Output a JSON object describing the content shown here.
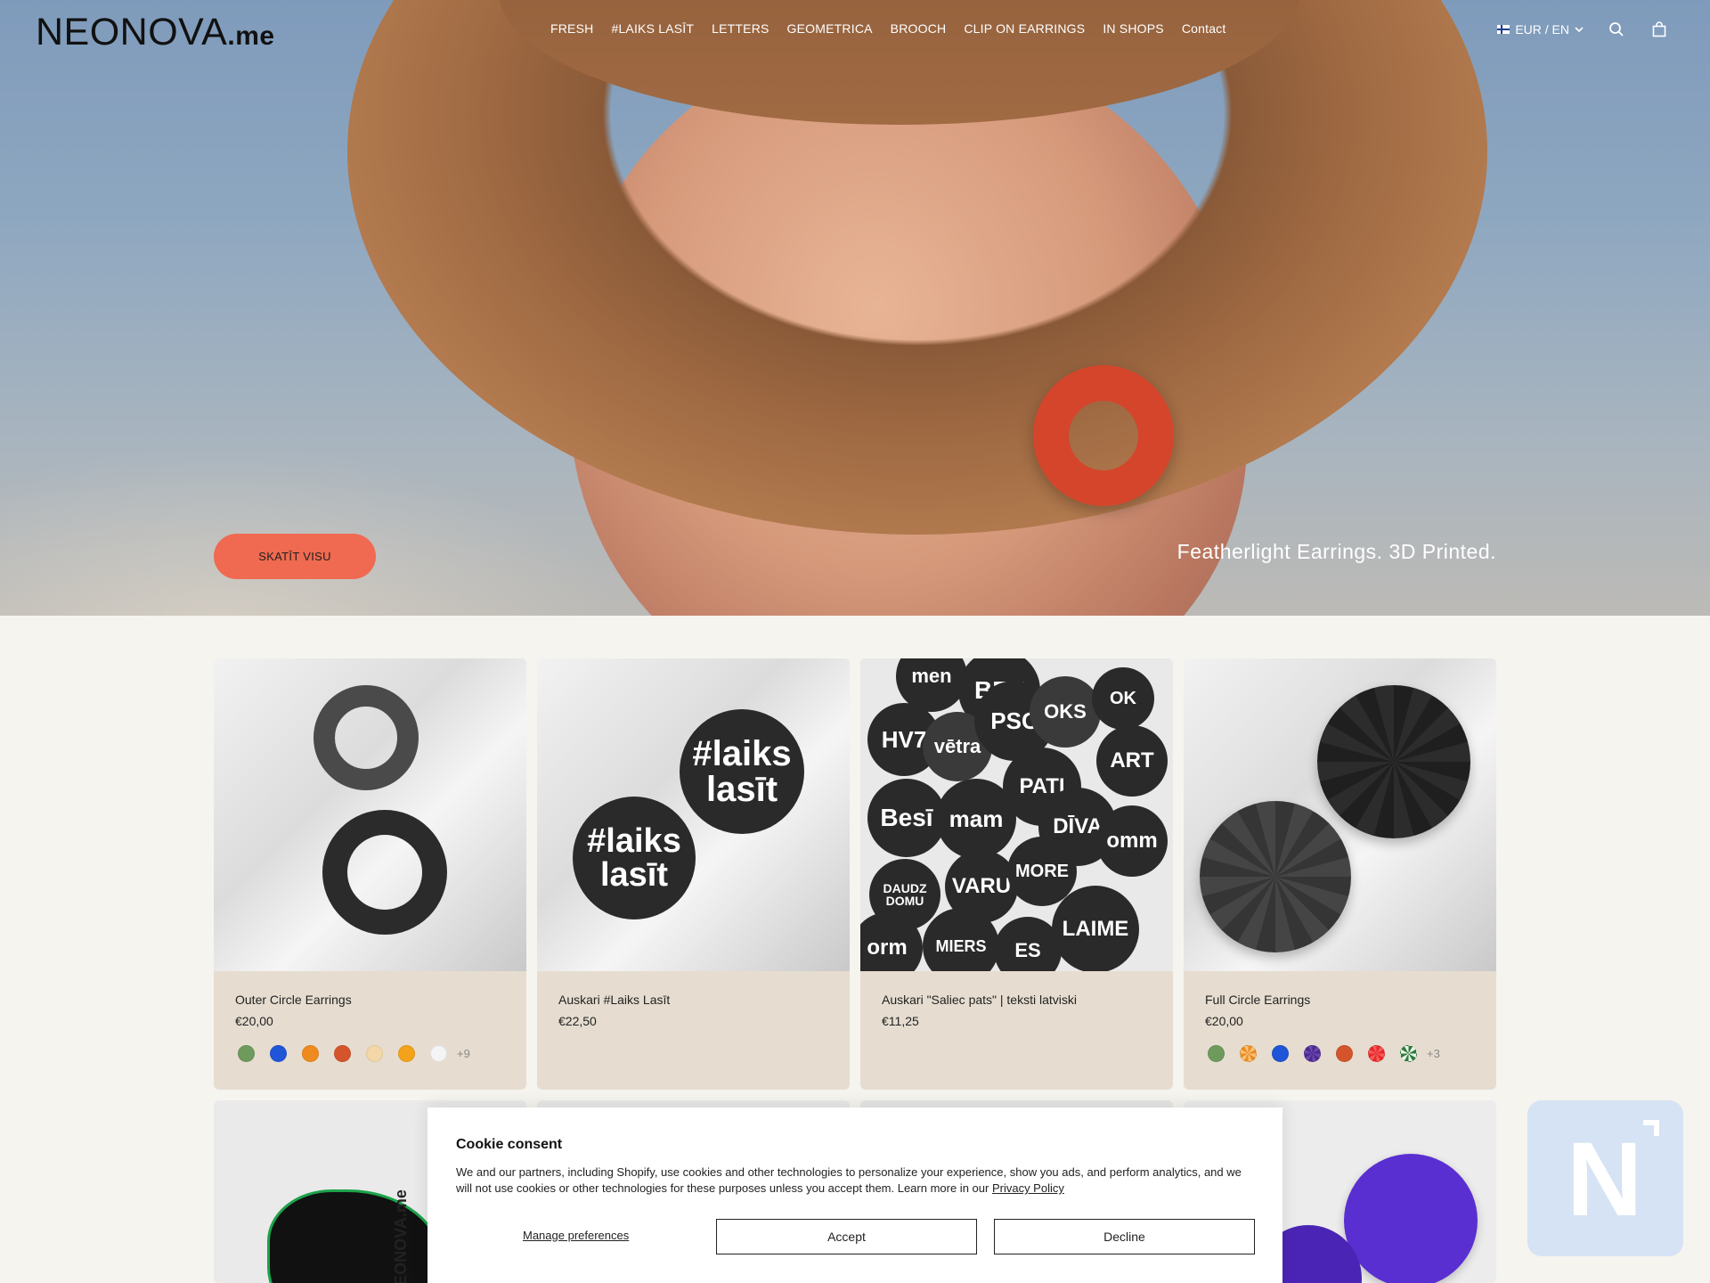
{
  "header": {
    "logo_main": "NEONOVA",
    "logo_suffix": ".me",
    "nav": [
      "FRESH",
      "#LAIKS LASĪT",
      "LETTERS",
      "GEOMETRICA",
      "BROOCH",
      "CLIP ON EARRINGS",
      "IN SHOPS",
      "Contact"
    ],
    "locale": "EUR / EN",
    "icons": {
      "flag": "finland-flag-icon",
      "search": "search-icon",
      "cart": "shopping-bag-icon",
      "chevron": "chevron-down-icon"
    }
  },
  "hero": {
    "cta": "SKATĪT VISU",
    "tagline": "Featherlight Earrings. 3D Printed.",
    "accent": "#ef6a50"
  },
  "products": [
    {
      "title": "Outer Circle Earrings",
      "price": "€20,00",
      "swatches": [
        "#6e9a5e",
        "#1f55d6",
        "#ef8a1e",
        "#d4552c",
        "#f3d7a8",
        "#f3a21a",
        "#f4f4f4"
      ],
      "more": "+9"
    },
    {
      "title": "Auskari #Laiks Lasīt",
      "price": "€22,50",
      "swatches": [],
      "more": "",
      "image_text": [
        "#laiks",
        "lasīt",
        "#laiks",
        "lasīt"
      ]
    },
    {
      "title": "Auskari \"Saliec pats\" | teksti latviski",
      "price": "€11,25",
      "swatches": [],
      "more": "",
      "image_text": [
        "men",
        "BET",
        "HV7",
        "vētra",
        "PSC",
        "OKS",
        "OK",
        "ART",
        "Besī",
        "mam",
        "PATI",
        "DĪVA",
        "omm",
        "DAUDZ DOMU",
        "VARU",
        "MORE",
        "LAIME",
        "orm",
        "MIERS",
        "ES"
      ]
    },
    {
      "title": "Full Circle Earrings",
      "price": "€20,00",
      "swatches": [
        "#6e9a5e",
        "#ef8a1e",
        "#1f55d6",
        "#4b2a8c",
        "#d4552c",
        "#e8282a",
        "#2e7d3a"
      ],
      "more": "+3"
    }
  ],
  "row2_image_text": [
    "NEONOVA.me"
  ],
  "cookie": {
    "title": "Cookie consent",
    "body": "We and our partners, including Shopify, use cookies and other technologies to personalize your experience, show you ads, and perform analytics, and we will not use cookies or other technologies for these purposes unless you accept them. Learn more in our ",
    "link": "Privacy Policy",
    "manage": "Manage preferences",
    "accept": "Accept",
    "decline": "Decline"
  }
}
